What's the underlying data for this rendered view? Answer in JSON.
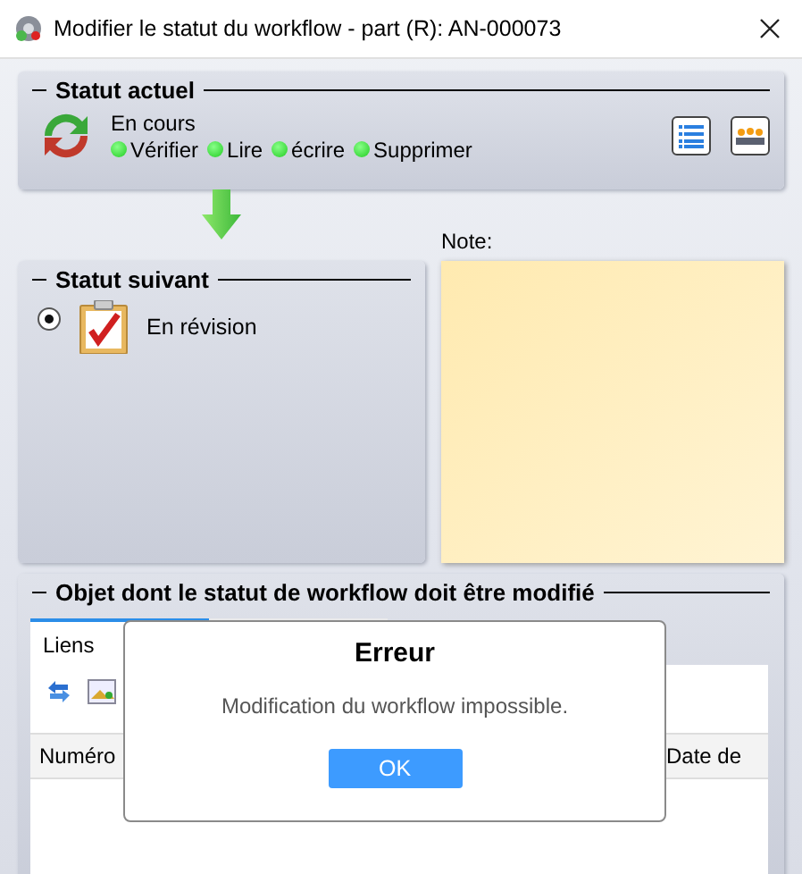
{
  "window": {
    "title": "Modifier le statut du workflow - part (R): AN-000073"
  },
  "current_status": {
    "title": "Statut actuel",
    "name": "En cours",
    "permissions": [
      {
        "label": "Vérifier",
        "allowed": true
      },
      {
        "label": "Lire",
        "allowed": true
      },
      {
        "label": "écrire",
        "allowed": true
      },
      {
        "label": "Supprimer",
        "allowed": true
      }
    ]
  },
  "next_status": {
    "title": "Statut suivant",
    "options": [
      {
        "label": "En révision",
        "selected": true
      }
    ]
  },
  "note": {
    "label": "Note:"
  },
  "object": {
    "title": "Objet dont le statut de workflow doit être modifié",
    "tabs": [
      {
        "label": "Liens",
        "selected": true
      }
    ],
    "table": {
      "columns": [
        "Numéro",
        "Date de"
      ]
    }
  },
  "dialog": {
    "title": "Erreur",
    "message": "Modification du workflow impossible.",
    "buttons": [
      "OK"
    ]
  }
}
